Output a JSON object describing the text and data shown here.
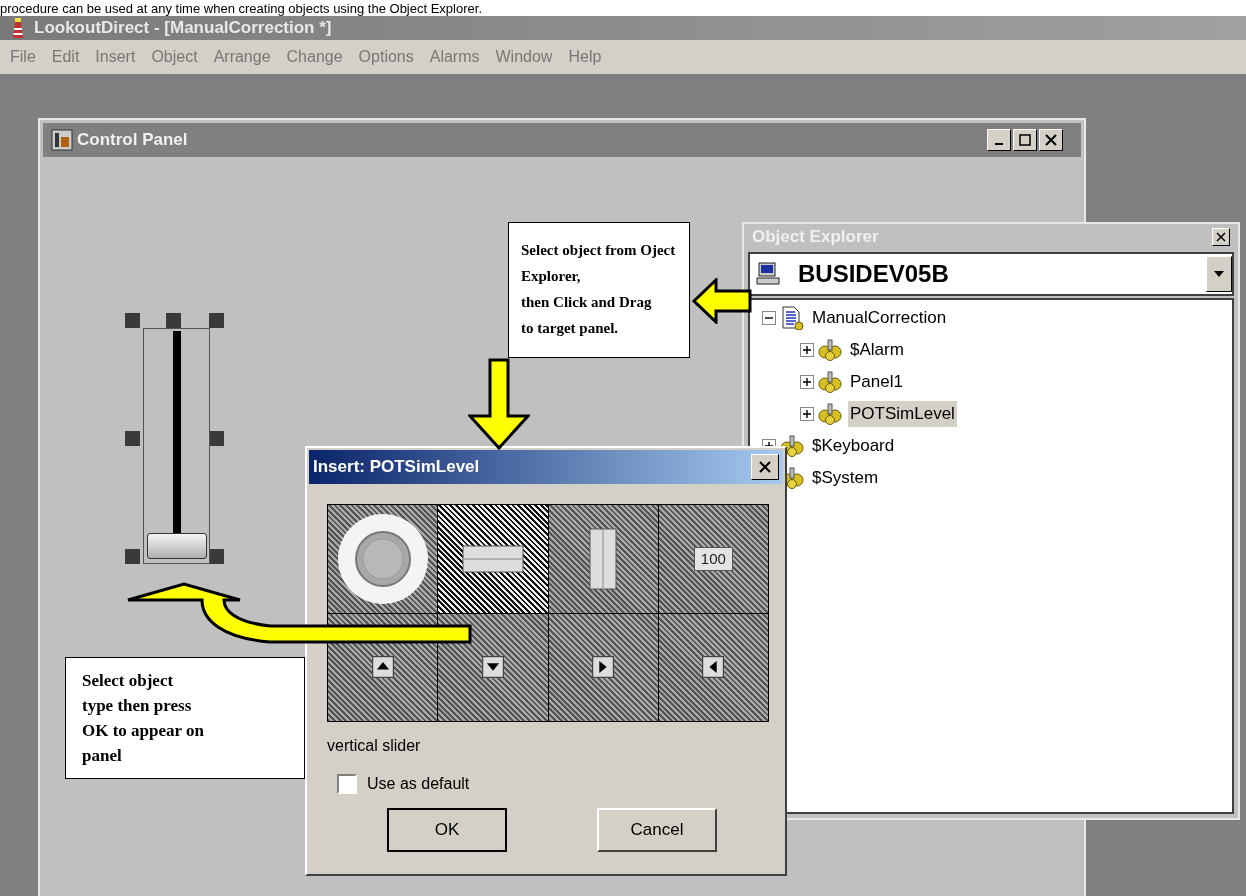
{
  "page_text": "procedure can be used at any time when creating objects using the Object Explorer.",
  "app": {
    "title": "LookoutDirect - [ManualCorrection *]",
    "menu": [
      "File",
      "Edit",
      "Insert",
      "Object",
      "Arrange",
      "Change",
      "Options",
      "Alarms",
      "Window",
      "Help"
    ]
  },
  "control_panel": {
    "title": "Control Panel",
    "slider": {
      "level": 0
    }
  },
  "object_explorer": {
    "title": "Object Explorer",
    "computer": "BUSIDEV05B",
    "tree": [
      {
        "label": "ManualCorrection",
        "kind": "document",
        "expanded": true,
        "selected": false,
        "children": [
          {
            "label": "$Alarm",
            "kind": "object",
            "expanded": false,
            "selected": false
          },
          {
            "label": "Panel1",
            "kind": "object",
            "expanded": false,
            "selected": false
          },
          {
            "label": "POTSimLevel",
            "kind": "object",
            "expanded": false,
            "selected": true
          }
        ]
      },
      {
        "label": "$Keyboard",
        "kind": "object",
        "expanded": false,
        "selected": false
      },
      {
        "label": "$System",
        "kind": "object",
        "selected": false
      }
    ]
  },
  "insert_dialog": {
    "title": "Insert: POTSimLevel",
    "types": [
      {
        "kind": "knob",
        "selected": false
      },
      {
        "kind": "horizontal-slider",
        "selected": true
      },
      {
        "kind": "vertical-slider",
        "selected": false
      },
      {
        "kind": "numeric",
        "label": "100",
        "selected": false
      },
      {
        "kind": "up",
        "selected": false
      },
      {
        "kind": "down",
        "selected": false
      },
      {
        "kind": "right",
        "selected": false
      },
      {
        "kind": "left",
        "selected": false
      }
    ],
    "caption": "vertical slider",
    "use_as_default": {
      "label": "Use as default",
      "checked": false
    },
    "buttons": [
      "OK",
      "Cancel"
    ]
  },
  "callouts": [
    "Select object from Oject Explorer,\nthen Click and Drag\nto target panel.",
    "Select object\ntype then press\nOK to appear on\npanel"
  ]
}
